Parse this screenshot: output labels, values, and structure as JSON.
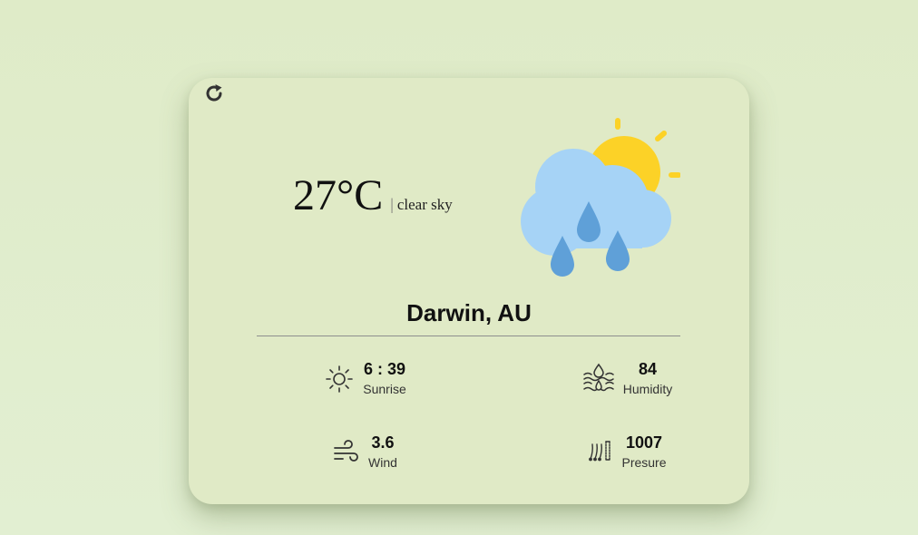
{
  "refresh": {
    "icon": "refresh-icon"
  },
  "current": {
    "temperature": "27°C",
    "separator": "|",
    "description": "clear sky",
    "icon": "rain-cloud-sun-icon"
  },
  "location": "Darwin, AU",
  "stats": {
    "sunrise": {
      "value": "6 : 39",
      "label": "Sunrise",
      "icon": "sun-outline-icon"
    },
    "humidity": {
      "value": "84",
      "label": "Humidity",
      "icon": "humidity-icon"
    },
    "wind": {
      "value": "3.6",
      "label": "Wind",
      "icon": "wind-icon"
    },
    "pressure": {
      "value": "1007",
      "label": "Presure",
      "icon": "pressure-icon"
    }
  },
  "colors": {
    "background": "#dfebc8",
    "card": "#e0eac6",
    "cloud": "#a6d3f6",
    "sun": "#fcd227",
    "drops": "#5fa0d8"
  }
}
